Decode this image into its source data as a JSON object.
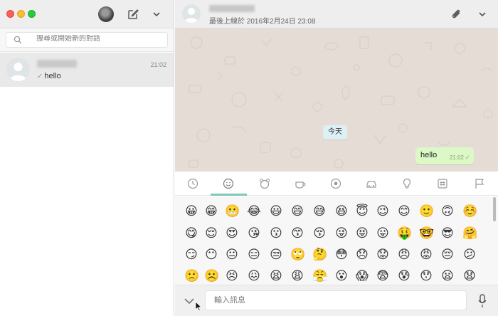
{
  "left": {
    "search": {
      "placeholder": "搜尋或開始新的對話"
    },
    "chats": [
      {
        "time": "21:02",
        "preview_tick": "✓",
        "preview": "hello"
      }
    ]
  },
  "right": {
    "last_seen": "最後上線於 2016年2月24日 23:08",
    "date_chip": "今天",
    "message": {
      "text": "hello",
      "time": "21:02",
      "tick": "✓"
    },
    "input": {
      "placeholder": "輸入訊息"
    }
  },
  "emoji_tabs": [
    "recent-icon",
    "smiley-icon",
    "animal-icon",
    "food-icon",
    "sports-icon",
    "travel-icon",
    "objects-icon",
    "symbols-icon",
    "flags-icon"
  ],
  "emoji_rows": [
    [
      "😀",
      "😁",
      "😬",
      "😂",
      "😃",
      "😄",
      "😅",
      "😆",
      "😇",
      "😉",
      "😊",
      "🙂",
      "🙃",
      "☺️"
    ],
    [
      "😋",
      "😌",
      "😍",
      "😘",
      "😗",
      "😙",
      "😚",
      "😜",
      "😝",
      "😛",
      "🤑",
      "🤓",
      "😎",
      "🤗"
    ],
    [
      "😏",
      "😶",
      "😐",
      "😑",
      "😒",
      "🙄",
      "🤔",
      "😳",
      "😞",
      "😟",
      "😠",
      "😡",
      "😔",
      "😕"
    ],
    [
      "🙁",
      "☹️",
      "😣",
      "😖",
      "😫",
      "😩",
      "😤",
      "😮",
      "😱",
      "😨",
      "😰",
      "😯",
      "😦",
      "😧"
    ]
  ],
  "colors": {
    "accent": "#7fc7b7",
    "bubble": "#dcf8c6",
    "chat_bg": "#e5ddd5"
  }
}
